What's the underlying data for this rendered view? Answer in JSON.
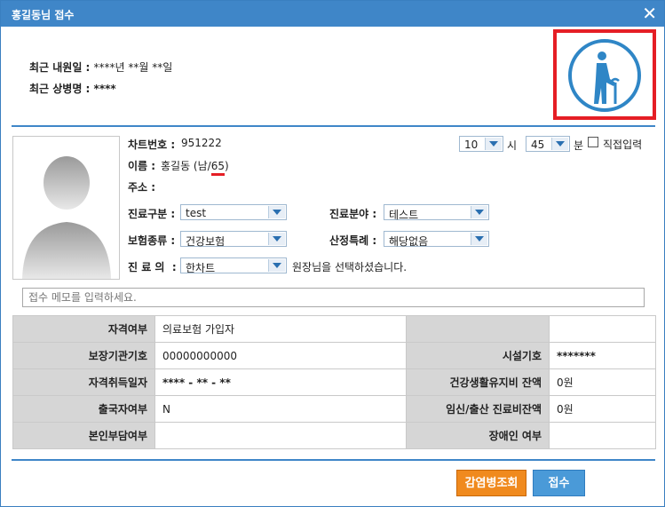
{
  "window": {
    "title": "홍길동님 접수",
    "close_symbol": "✕"
  },
  "recent": {
    "visit_label": "최근 내원일 :",
    "visit_value": "****년 **월 **일",
    "disease_label": "최근 상병명 :",
    "disease_value": "****"
  },
  "patient": {
    "chart_no_label": "차트번호 :",
    "chart_no": "951222",
    "name_label": "이름 :",
    "name_prefix": "홍길동 (남/",
    "age": "65",
    "name_suffix": ")",
    "address_label": "주소 :"
  },
  "time": {
    "hour": "10",
    "hour_label": "시",
    "minute": "45",
    "minute_label": "분",
    "manual_label": "직접입력"
  },
  "form": {
    "care_type_label": "진료구분 :",
    "care_type": "test",
    "care_field_label": "진료분야 :",
    "care_field": "테스트",
    "insurance_label": "보험종류 :",
    "insurance": "건강보험",
    "special_label": "산정특례 :",
    "special": "해당없음",
    "doctor_label": "진 료 의  :",
    "doctor": "한차트",
    "doctor_note": "원장님을 선택하셨습니다."
  },
  "memo": {
    "placeholder": "접수 메모를 입력하세요."
  },
  "info_table": {
    "rows": [
      {
        "h1": "자격여부",
        "v1": "의료보험 가입자",
        "h2": "",
        "v2": ""
      },
      {
        "h1": "보장기관기호",
        "v1": "00000000000",
        "h2": "시설기호",
        "v2": "*******"
      },
      {
        "h1": "자격취득일자",
        "v1": "**** - ** - **",
        "h2": "건강생활유지비 잔액",
        "v2": "0원"
      },
      {
        "h1": "출국자여부",
        "v1": "N",
        "h2": "임신/출산 진료비잔액",
        "v2": "0원"
      },
      {
        "h1": "본인부담여부",
        "v1": "",
        "h2": "장애인 여부",
        "v2": ""
      }
    ]
  },
  "buttons": {
    "infection": "감염병조회",
    "register": "접수"
  },
  "colors": {
    "accent": "#3f86c8",
    "alert": "#e51e25",
    "orange": "#f08a1e"
  }
}
